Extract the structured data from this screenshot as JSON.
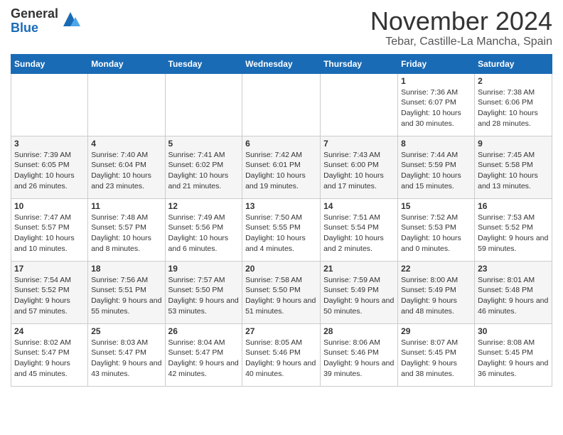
{
  "header": {
    "logo_general": "General",
    "logo_blue": "Blue",
    "month": "November 2024",
    "location": "Tebar, Castille-La Mancha, Spain"
  },
  "weekdays": [
    "Sunday",
    "Monday",
    "Tuesday",
    "Wednesday",
    "Thursday",
    "Friday",
    "Saturday"
  ],
  "weeks": [
    [
      {
        "day": "",
        "info": ""
      },
      {
        "day": "",
        "info": ""
      },
      {
        "day": "",
        "info": ""
      },
      {
        "day": "",
        "info": ""
      },
      {
        "day": "",
        "info": ""
      },
      {
        "day": "1",
        "info": "Sunrise: 7:36 AM\nSunset: 6:07 PM\nDaylight: 10 hours and 30 minutes."
      },
      {
        "day": "2",
        "info": "Sunrise: 7:38 AM\nSunset: 6:06 PM\nDaylight: 10 hours and 28 minutes."
      }
    ],
    [
      {
        "day": "3",
        "info": "Sunrise: 7:39 AM\nSunset: 6:05 PM\nDaylight: 10 hours and 26 minutes."
      },
      {
        "day": "4",
        "info": "Sunrise: 7:40 AM\nSunset: 6:04 PM\nDaylight: 10 hours and 23 minutes."
      },
      {
        "day": "5",
        "info": "Sunrise: 7:41 AM\nSunset: 6:02 PM\nDaylight: 10 hours and 21 minutes."
      },
      {
        "day": "6",
        "info": "Sunrise: 7:42 AM\nSunset: 6:01 PM\nDaylight: 10 hours and 19 minutes."
      },
      {
        "day": "7",
        "info": "Sunrise: 7:43 AM\nSunset: 6:00 PM\nDaylight: 10 hours and 17 minutes."
      },
      {
        "day": "8",
        "info": "Sunrise: 7:44 AM\nSunset: 5:59 PM\nDaylight: 10 hours and 15 minutes."
      },
      {
        "day": "9",
        "info": "Sunrise: 7:45 AM\nSunset: 5:58 PM\nDaylight: 10 hours and 13 minutes."
      }
    ],
    [
      {
        "day": "10",
        "info": "Sunrise: 7:47 AM\nSunset: 5:57 PM\nDaylight: 10 hours and 10 minutes."
      },
      {
        "day": "11",
        "info": "Sunrise: 7:48 AM\nSunset: 5:57 PM\nDaylight: 10 hours and 8 minutes."
      },
      {
        "day": "12",
        "info": "Sunrise: 7:49 AM\nSunset: 5:56 PM\nDaylight: 10 hours and 6 minutes."
      },
      {
        "day": "13",
        "info": "Sunrise: 7:50 AM\nSunset: 5:55 PM\nDaylight: 10 hours and 4 minutes."
      },
      {
        "day": "14",
        "info": "Sunrise: 7:51 AM\nSunset: 5:54 PM\nDaylight: 10 hours and 2 minutes."
      },
      {
        "day": "15",
        "info": "Sunrise: 7:52 AM\nSunset: 5:53 PM\nDaylight: 10 hours and 0 minutes."
      },
      {
        "day": "16",
        "info": "Sunrise: 7:53 AM\nSunset: 5:52 PM\nDaylight: 9 hours and 59 minutes."
      }
    ],
    [
      {
        "day": "17",
        "info": "Sunrise: 7:54 AM\nSunset: 5:52 PM\nDaylight: 9 hours and 57 minutes."
      },
      {
        "day": "18",
        "info": "Sunrise: 7:56 AM\nSunset: 5:51 PM\nDaylight: 9 hours and 55 minutes."
      },
      {
        "day": "19",
        "info": "Sunrise: 7:57 AM\nSunset: 5:50 PM\nDaylight: 9 hours and 53 minutes."
      },
      {
        "day": "20",
        "info": "Sunrise: 7:58 AM\nSunset: 5:50 PM\nDaylight: 9 hours and 51 minutes."
      },
      {
        "day": "21",
        "info": "Sunrise: 7:59 AM\nSunset: 5:49 PM\nDaylight: 9 hours and 50 minutes."
      },
      {
        "day": "22",
        "info": "Sunrise: 8:00 AM\nSunset: 5:49 PM\nDaylight: 9 hours and 48 minutes."
      },
      {
        "day": "23",
        "info": "Sunrise: 8:01 AM\nSunset: 5:48 PM\nDaylight: 9 hours and 46 minutes."
      }
    ],
    [
      {
        "day": "24",
        "info": "Sunrise: 8:02 AM\nSunset: 5:47 PM\nDaylight: 9 hours and 45 minutes."
      },
      {
        "day": "25",
        "info": "Sunrise: 8:03 AM\nSunset: 5:47 PM\nDaylight: 9 hours and 43 minutes."
      },
      {
        "day": "26",
        "info": "Sunrise: 8:04 AM\nSunset: 5:47 PM\nDaylight: 9 hours and 42 minutes."
      },
      {
        "day": "27",
        "info": "Sunrise: 8:05 AM\nSunset: 5:46 PM\nDaylight: 9 hours and 40 minutes."
      },
      {
        "day": "28",
        "info": "Sunrise: 8:06 AM\nSunset: 5:46 PM\nDaylight: 9 hours and 39 minutes."
      },
      {
        "day": "29",
        "info": "Sunrise: 8:07 AM\nSunset: 5:45 PM\nDaylight: 9 hours and 38 minutes."
      },
      {
        "day": "30",
        "info": "Sunrise: 8:08 AM\nSunset: 5:45 PM\nDaylight: 9 hours and 36 minutes."
      }
    ]
  ]
}
